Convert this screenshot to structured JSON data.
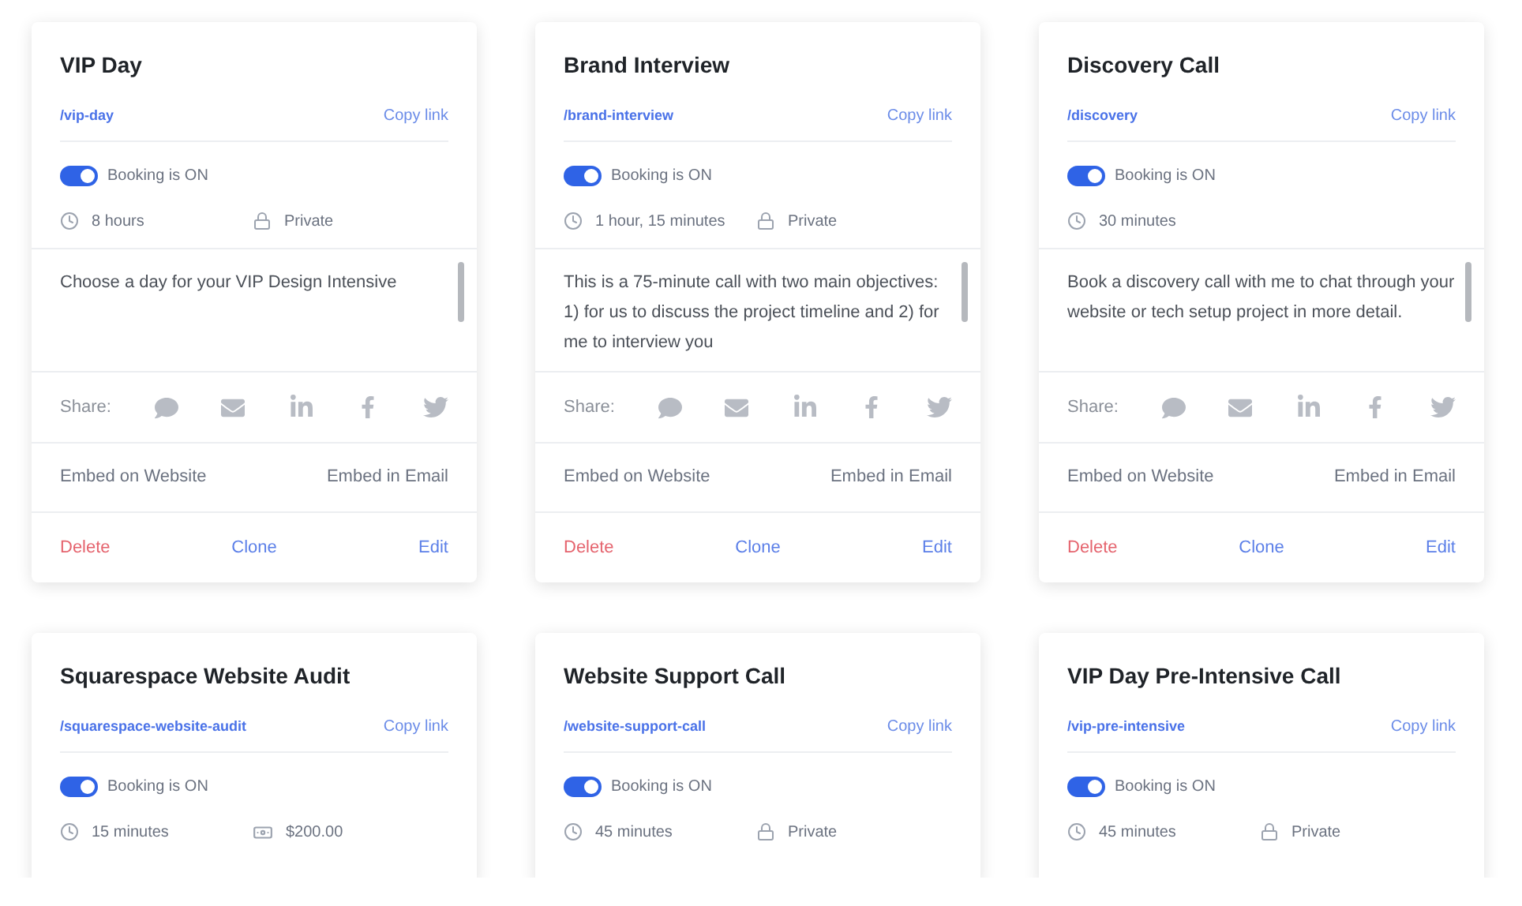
{
  "cards": [
    {
      "title": "VIP Day",
      "slug": "/vip-day",
      "copy_link": "Copy link",
      "booking": {
        "on": true,
        "label": "Booking is ON"
      },
      "details": [
        {
          "kind": "duration",
          "text": "8 hours"
        },
        {
          "kind": "private",
          "text": "Private"
        }
      ],
      "description": "Choose a day for your VIP Design Intensive",
      "share": {
        "label": "Share:"
      },
      "embed": [
        "Embed on Website",
        "Embed in Email"
      ],
      "actions": [
        {
          "kind": "delete",
          "label": "Delete"
        },
        {
          "kind": "clone",
          "label": "Clone"
        },
        {
          "kind": "edit",
          "label": "Edit"
        }
      ]
    },
    {
      "title": "Brand Interview",
      "slug": "/brand-interview",
      "copy_link": "Copy link",
      "booking": {
        "on": true,
        "label": "Booking is ON"
      },
      "details": [
        {
          "kind": "duration",
          "text": "1 hour, 15 minutes"
        },
        {
          "kind": "private",
          "text": "Private"
        }
      ],
      "description": "This is a 75-minute call with two main objectives: 1) for us to discuss the project timeline and 2) for me to interview you",
      "share": {
        "label": "Share:"
      },
      "embed": [
        "Embed on Website",
        "Embed in Email"
      ],
      "actions": [
        {
          "kind": "delete",
          "label": "Delete"
        },
        {
          "kind": "clone",
          "label": "Clone"
        },
        {
          "kind": "edit",
          "label": "Edit"
        }
      ]
    },
    {
      "title": "Discovery Call",
      "slug": "/discovery",
      "copy_link": "Copy link",
      "booking": {
        "on": true,
        "label": "Booking is ON"
      },
      "details": [
        {
          "kind": "duration",
          "text": "30 minutes"
        }
      ],
      "description": "Book a discovery call with me to chat through your website or tech setup project in more detail.",
      "share": {
        "label": "Share:"
      },
      "embed": [
        "Embed on Website",
        "Embed in Email"
      ],
      "actions": [
        {
          "kind": "delete",
          "label": "Delete"
        },
        {
          "kind": "clone",
          "label": "Clone"
        },
        {
          "kind": "edit",
          "label": "Edit"
        }
      ]
    },
    {
      "title": "Squarespace Website Audit",
      "slug": "/squarespace-website-audit",
      "copy_link": "Copy link",
      "booking": {
        "on": true,
        "label": "Booking is ON"
      },
      "details": [
        {
          "kind": "duration",
          "text": "15 minutes"
        },
        {
          "kind": "price",
          "text": "$200.00"
        }
      ]
    },
    {
      "title": "Website Support Call",
      "slug": "/website-support-call",
      "copy_link": "Copy link",
      "booking": {
        "on": true,
        "label": "Booking is ON"
      },
      "details": [
        {
          "kind": "duration",
          "text": "45 minutes"
        },
        {
          "kind": "private",
          "text": "Private"
        }
      ]
    },
    {
      "title": "VIP Day Pre-Intensive Call",
      "slug": "/vip-pre-intensive",
      "copy_link": "Copy link",
      "booking": {
        "on": true,
        "label": "Booking is ON"
      },
      "details": [
        {
          "kind": "duration",
          "text": "45 minutes"
        },
        {
          "kind": "private",
          "text": "Private"
        }
      ]
    }
  ]
}
